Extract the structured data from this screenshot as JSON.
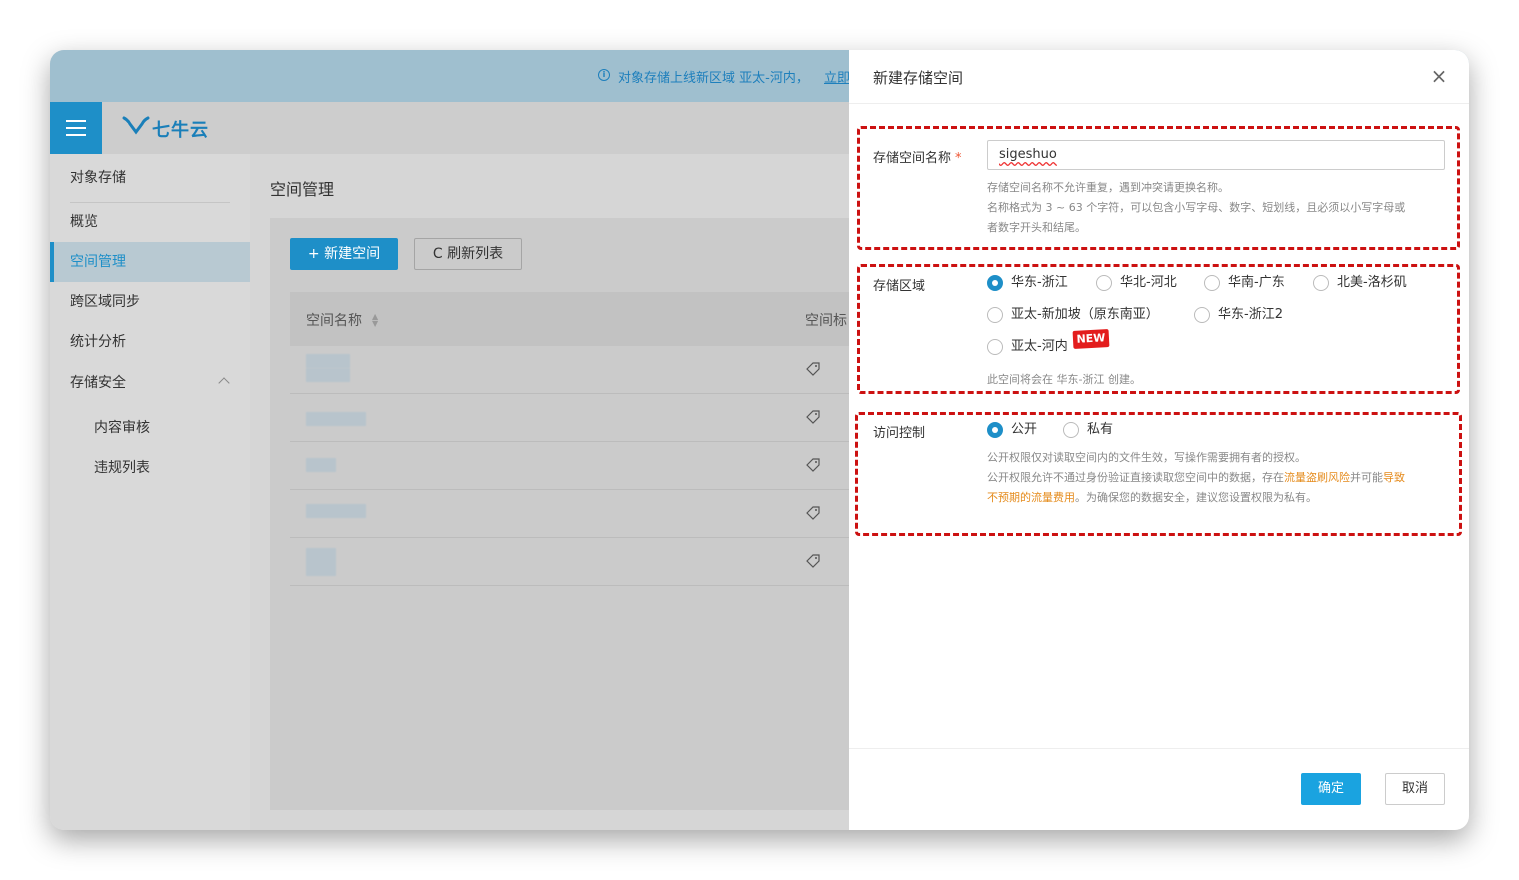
{
  "banner": {
    "text": "对象存储上线新区域 亚太-河内，",
    "link": "立即"
  },
  "logo": {
    "text": "七牛云"
  },
  "sidebar": {
    "items": [
      {
        "label": "对象存储"
      },
      {
        "label": "概览"
      },
      {
        "label": "空间管理"
      },
      {
        "label": "跨区域同步"
      },
      {
        "label": "统计分析"
      },
      {
        "label": "存储安全"
      },
      {
        "label": "内容审核"
      },
      {
        "label": "违规列表"
      }
    ]
  },
  "main": {
    "title": "空间管理",
    "new_button": "+ 新建空间",
    "refresh_button": "C 刷新列表",
    "table": {
      "col_name": "空间名称",
      "col_tag": "空间标"
    }
  },
  "drawer": {
    "title": "新建存储空间",
    "close": "×",
    "name_field": {
      "label": "存储空间名称",
      "required": "*",
      "value": "sigeshuo",
      "hint1": "存储空间名称不允许重复，遇到冲突请更换名称。",
      "hint2": "名称格式为 3 ~ 63 个字符，可以包含小写字母、数字、短划线，且必须以小写字母或",
      "hint3": "者数字开头和结尾。"
    },
    "region_field": {
      "label": "存储区域",
      "options": [
        "华东-浙江",
        "华北-河北",
        "华南-广东",
        "北美-洛杉矶",
        "亚太-新加坡（原东南亚）",
        "华东-浙江2",
        "亚太-河内"
      ],
      "selected": "华东-浙江",
      "new_badge": "NEW",
      "note": "此空间将会在 华东-浙江 创建。"
    },
    "access_field": {
      "label": "访问控制",
      "options": [
        "公开",
        "私有"
      ],
      "selected": "公开",
      "hint1": "公开权限仅对读取空间内的文件生效，写操作需要拥有者的授权。",
      "hint2_a": "公开权限允许不通过身份验证直接读取您空间中的数据，存在",
      "hint2_warn1": "流量盗刷风险",
      "hint2_b": "并可能",
      "hint2_warn2": "导致",
      "hint3_warn": "不预期的流量费用",
      "hint3_b": "。为确保您的数据安全，建议您设置权限为私有。"
    },
    "confirm": "确定",
    "cancel": "取消"
  },
  "colors": {
    "accent": "#1e8fc8",
    "confirm": "#1aa3e0",
    "annotation": "#cc1111",
    "warning": "#e58b1c"
  }
}
